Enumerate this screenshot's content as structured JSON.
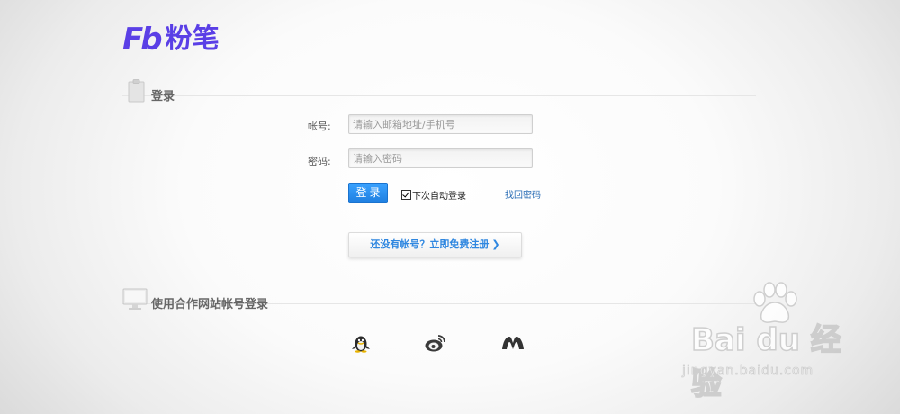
{
  "brand": {
    "logo_mark": "Fb",
    "logo_text": "粉笔",
    "color": "#5a3fe6"
  },
  "login_section": {
    "title": "登录",
    "icon": "clipboard-icon"
  },
  "form": {
    "account_label": "帐号:",
    "account_placeholder": "请输入邮箱地址/手机号",
    "account_value": "",
    "password_label": "密码:",
    "password_placeholder": "请输入密码",
    "password_value": "",
    "login_button": "登录",
    "remember_label": "下次自动登录",
    "remember_checked": true,
    "forgot_link": "找回密码",
    "register_button": "还没有帐号？立即免费注册",
    "accent_color": "#1f7fe0"
  },
  "partner_section": {
    "title": "使用合作网站帐号登录",
    "icon": "monitor-icon",
    "partners": [
      {
        "name": "qq",
        "icon": "qq-penguin-icon"
      },
      {
        "name": "weibo",
        "icon": "weibo-icon"
      },
      {
        "name": "renren",
        "icon": "renren-icon"
      }
    ]
  },
  "watermark": {
    "main": "Bai du 经验",
    "sub": "jingyan.baidu.com"
  }
}
